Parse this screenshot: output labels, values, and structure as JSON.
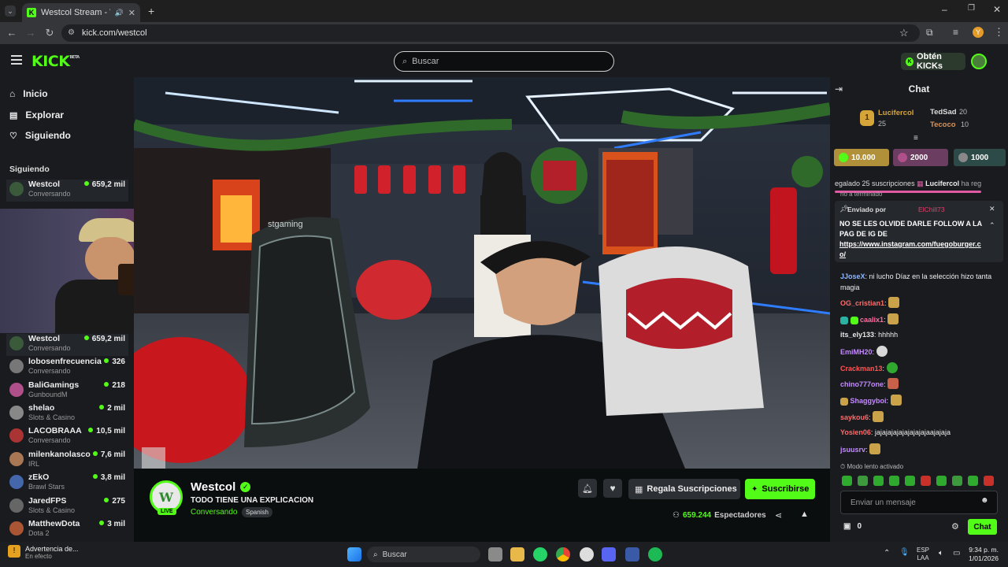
{
  "browser": {
    "tab_title": "Westcol Stream - Watch Li",
    "url": "kick.com/westcol",
    "profile_initial": "Y"
  },
  "header": {
    "logo": "KICK",
    "logo_badge": "BETA",
    "search_placeholder": "Buscar",
    "kicks_label": "Obtén KICKs"
  },
  "sidebar": {
    "nav": [
      {
        "label": "Inicio",
        "icon": "home-icon"
      },
      {
        "label": "Explorar",
        "icon": "explore-icon"
      },
      {
        "label": "Siguiendo",
        "icon": "heart-icon"
      }
    ],
    "following_title": "Siguiendo",
    "following": [
      {
        "name": "Westcol",
        "category": "Conversando",
        "viewers": "659,2 mil",
        "color": "#3a5a3a"
      },
      {
        "name": "Westcol",
        "category": "Conversando",
        "viewers": "659,2 mil",
        "color": "#3a5a3a"
      },
      {
        "name": "lobosenfrecuencia",
        "category": "Conversando",
        "viewers": "326",
        "color": "#777777"
      },
      {
        "name": "BaliGamings",
        "category": "GunboundM",
        "viewers": "218",
        "color": "#b0508a"
      },
      {
        "name": "shelao",
        "category": "Slots & Casino",
        "viewers": "2 mil",
        "color": "#888888"
      },
      {
        "name": "LACOBRAAA",
        "category": "Conversando",
        "viewers": "10,5 mil",
        "color": "#aa3333"
      },
      {
        "name": "milenkanolasco",
        "category": "IRL",
        "viewers": "7,6 mil",
        "color": "#aa7755"
      },
      {
        "name": "zEkO",
        "category": "Brawl Stars",
        "viewers": "3,8 mil",
        "color": "#4466aa"
      },
      {
        "name": "JaredFPS",
        "category": "Slots & Casino",
        "viewers": "275",
        "color": "#666666"
      },
      {
        "name": "MatthewDota",
        "category": "Dota 2",
        "viewers": "3 mil",
        "color": "#aa5533"
      }
    ]
  },
  "stream": {
    "chair_brand": "stgaming",
    "channel_name": "Westcol",
    "title": "TODO TIENE UNA EXPLICACION",
    "category": "Conversando",
    "language": "Spanish",
    "live_badge": "LIVE",
    "viewers_count": "659.244",
    "viewers_label": "Espectadores",
    "gift_label": "Regala Suscripciones",
    "subscribe_label": "Suscribirse"
  },
  "chat": {
    "title": "Chat",
    "leaderboard": [
      {
        "rank": "1",
        "name": "Lucifercol",
        "count": "25"
      },
      {
        "name": "TedSad",
        "count": "20"
      },
      {
        "name": "Tecoco",
        "count": "10"
      }
    ],
    "gift_goals": [
      "10.000",
      "2000",
      "1000"
    ],
    "ticker": "egalado 25 suscripciones",
    "ticker_user": "Lucifercol",
    "ticker_tail": "ha reg",
    "ended_text": "no a terminado",
    "pinned_sent_by": "Enviado por",
    "pinned_user": "ElChill73",
    "pinned_text": "NO SE LES OLVIDE DARLE FOLLOW A LA PAG DE IG DE",
    "pinned_link": "https://www.instagram.com/fuegoburger.co/",
    "messages": [
      {
        "user": "JJoseX",
        "color": "#8fb7ff",
        "text": " ni lucho Díaz en la selección hizo tanta magia"
      },
      {
        "user": "OG_cristian1",
        "color": "#ff6b6b",
        "text": ""
      },
      {
        "user": "caalix1",
        "color": "#ff6b9e",
        "text": ""
      },
      {
        "user": "its_ely133",
        "color": "#e8e8e8",
        "text": " hhhhh"
      },
      {
        "user": "EmiMH20",
        "color": "#c48bff",
        "text": ""
      },
      {
        "user": "Crackman13",
        "color": "#ff5555",
        "text": ""
      },
      {
        "user": "chino777one",
        "color": "#c48bff",
        "text": ""
      },
      {
        "user": "Shaggyboi",
        "color": "#c48bff",
        "text": ""
      },
      {
        "user": "saykou6",
        "color": "#ff6b6b",
        "text": ""
      },
      {
        "user": "Yosien06",
        "color": "#ff6b6b",
        "text": " jajajajajajajajajajaajajaja"
      },
      {
        "user": "jsuusrv",
        "color": "#c48bff",
        "text": ""
      }
    ],
    "slow_mode": "Modo lento activado",
    "input_placeholder": "Enviar un mensaje",
    "kicks_count": "0",
    "send_label": "Chat"
  },
  "taskbar": {
    "notification_title": "Advertencia de...",
    "notification_sub": "En efecto",
    "search_label": "Buscar",
    "lang_top": "ESP",
    "lang_bottom": "LAA",
    "time": "9:34 p. m.",
    "date": "1/01/2026"
  }
}
